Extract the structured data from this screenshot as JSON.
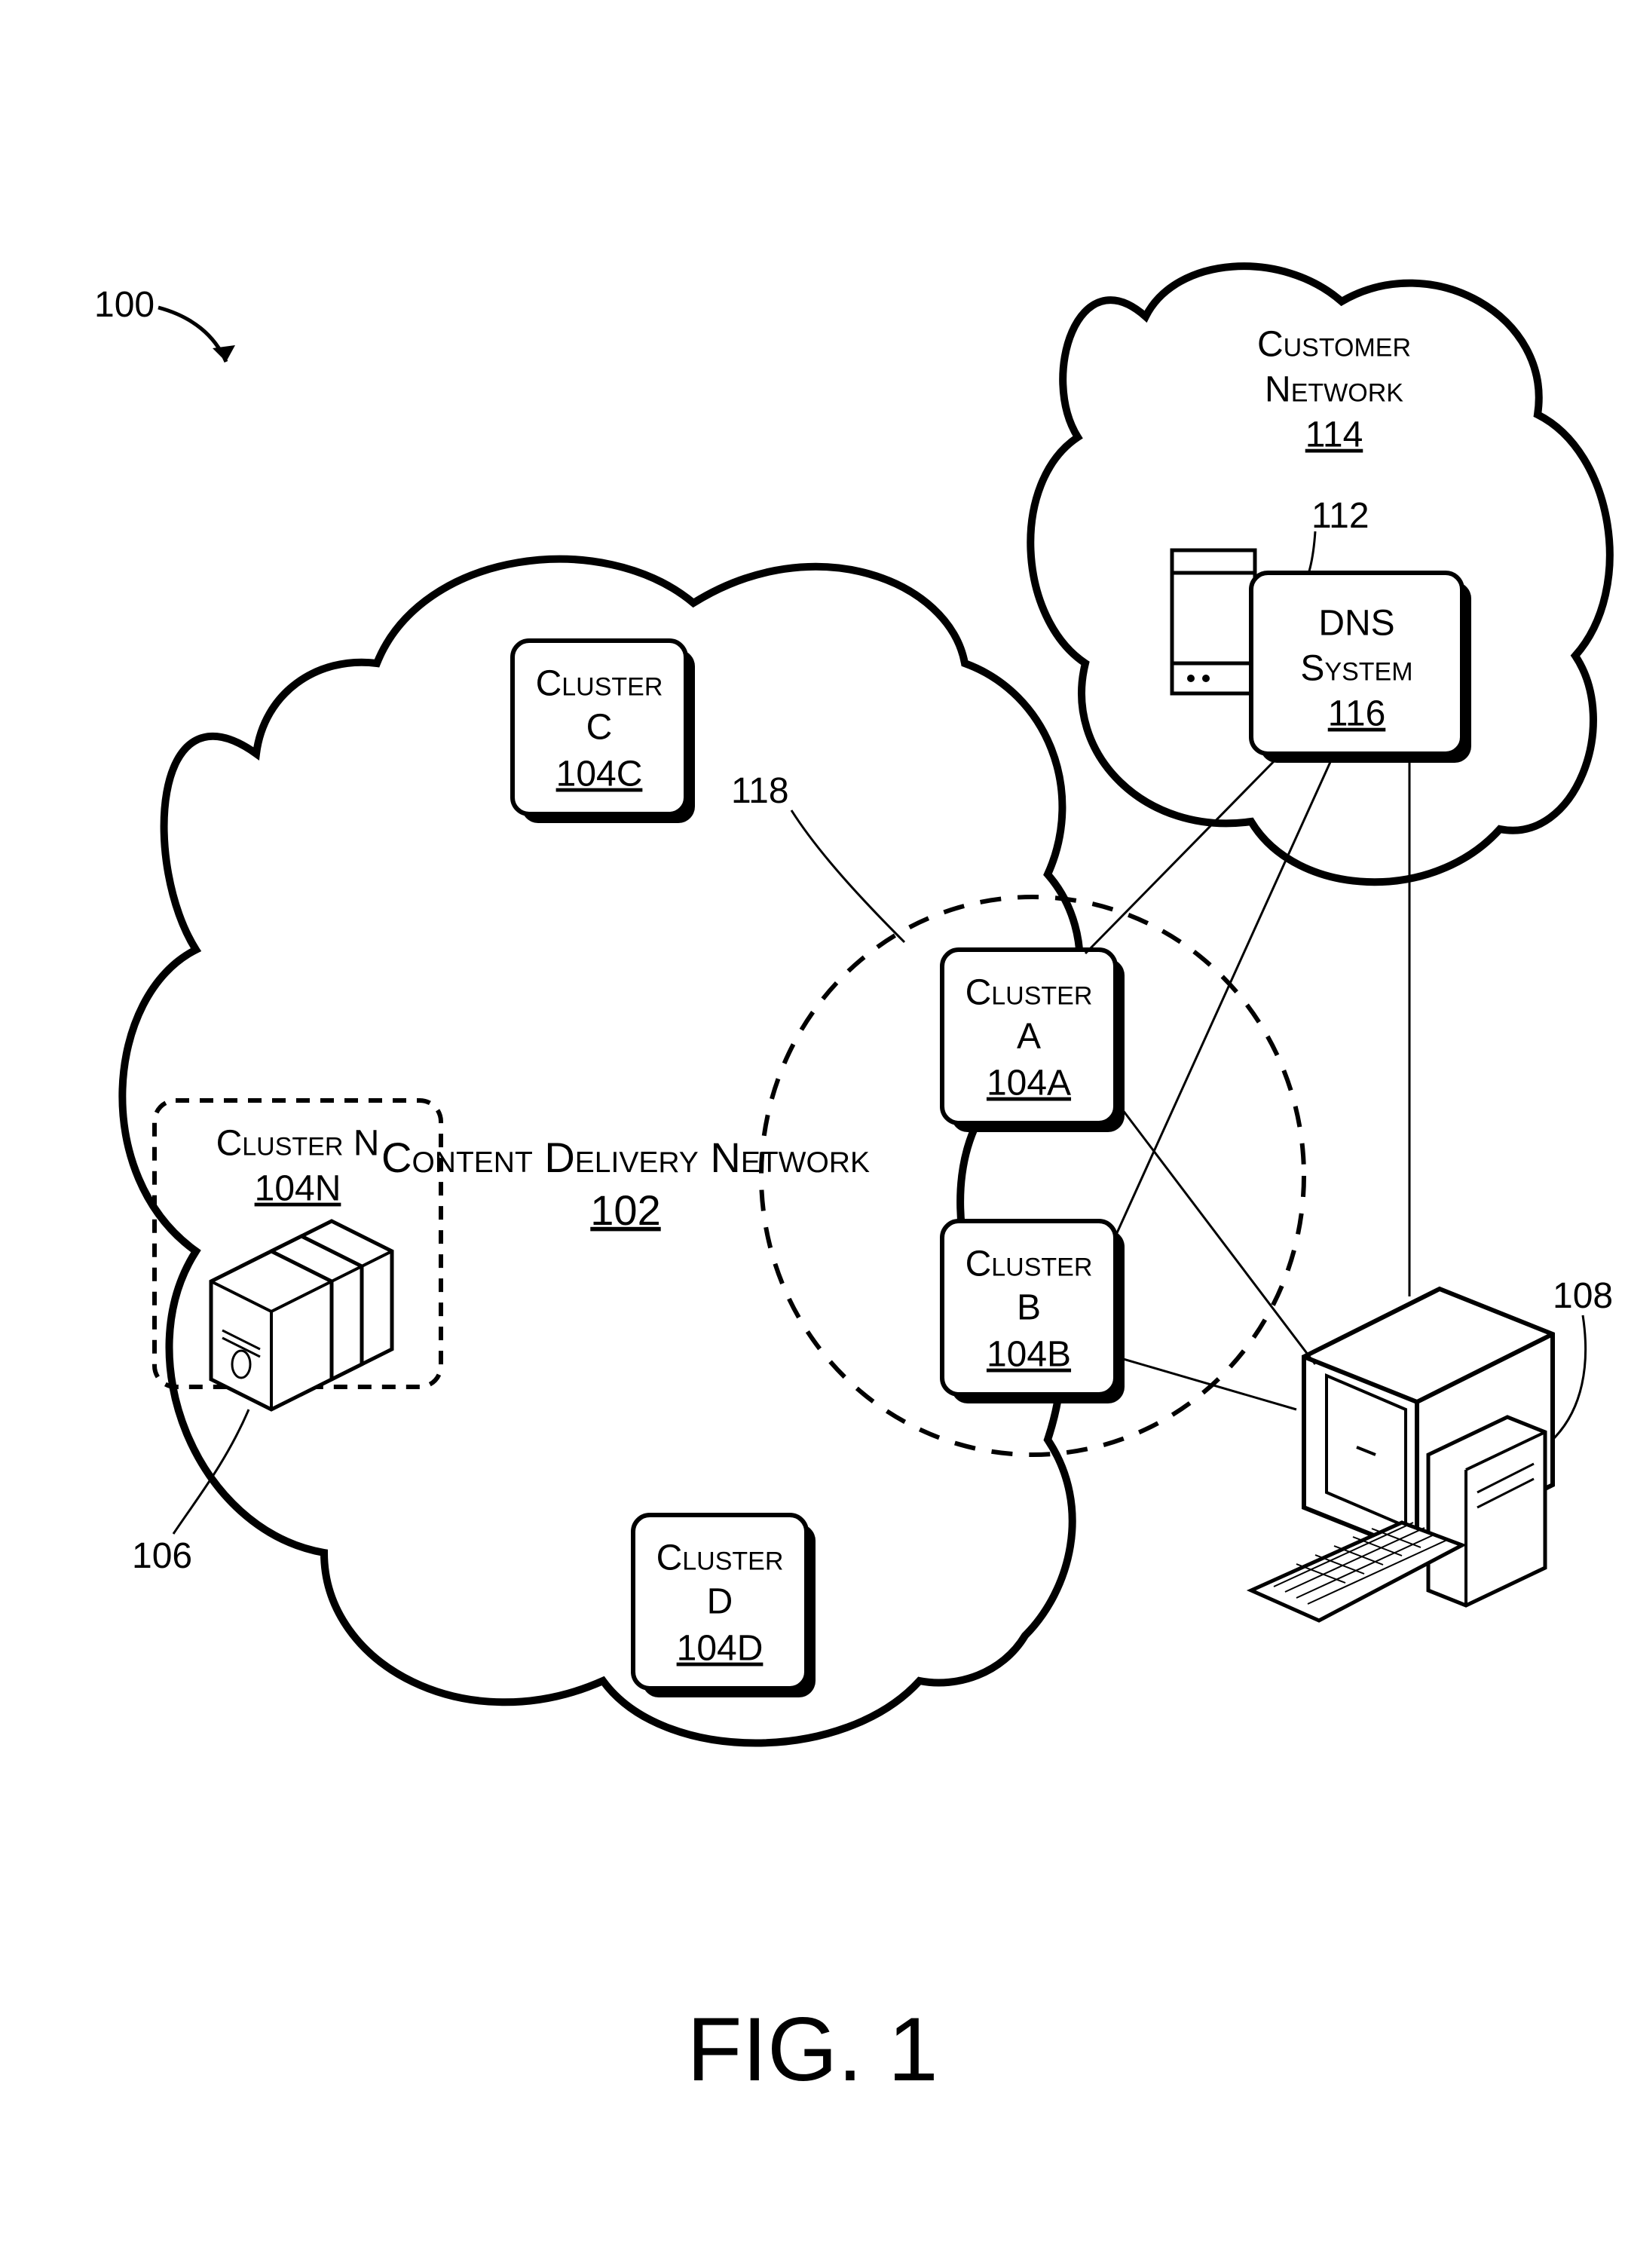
{
  "figure": {
    "label": "FIG. 1",
    "overall_ref": "100"
  },
  "cdn": {
    "label_line1": "Content Delivery Network",
    "ref": "102"
  },
  "customer_network": {
    "label_line1": "Customer",
    "label_line2": "Network",
    "ref": "114",
    "origin_server_ref": "112"
  },
  "dns": {
    "label_line1": "DNS",
    "label_line2": "System",
    "ref": "116"
  },
  "clusters": {
    "a": {
      "label": "Cluster",
      "letter": "A",
      "ref": "104A"
    },
    "b": {
      "label": "Cluster",
      "letter": "B",
      "ref": "104B"
    },
    "c": {
      "label": "Cluster",
      "letter": "C",
      "ref": "104C"
    },
    "d": {
      "label": "Cluster",
      "letter": "D",
      "ref": "104D"
    },
    "n": {
      "label": "Cluster N",
      "ref": "104N"
    }
  },
  "virtual_cluster_ref": "118",
  "servers_ref": "106",
  "client_ref": "108"
}
